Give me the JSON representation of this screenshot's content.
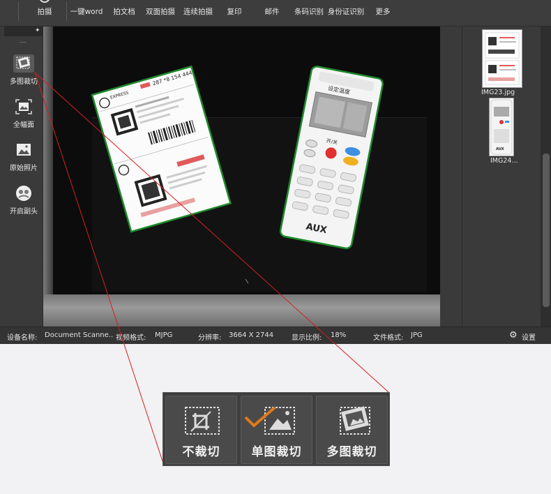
{
  "toolbar": {
    "capture_label": "拍摄",
    "word_label": "一键word",
    "doc_label": "拍文档",
    "duplex_label": "双面拍摄",
    "continuous_label": "连续拍摄",
    "copy_label": "复印",
    "mail_label": "邮件",
    "barcode_label": "条码识别",
    "idcard_label": "身份证识别",
    "more_label": "更多"
  },
  "sidebar": {
    "items": [
      {
        "label": "多图裁切",
        "icon": "multi-crop-icon",
        "active": true
      },
      {
        "label": "全幅面",
        "icon": "full-frame-icon",
        "active": false
      },
      {
        "label": "原始照片",
        "icon": "original-photo-icon",
        "active": false
      },
      {
        "label": "开启副头",
        "icon": "secondary-camera-icon",
        "active": false
      }
    ]
  },
  "thumbnails": [
    {
      "name": "IMG23.jpg"
    },
    {
      "name": "IMG24..."
    }
  ],
  "preview": {
    "waybill_brand": "EXPRESS",
    "waybill_number": "287 *8 154 444",
    "remote_title": "设定温度",
    "remote_power_label": "开/关",
    "remote_brand": "AUX"
  },
  "status": {
    "device_label": "设备名称:",
    "device_value": "Document Scanne..",
    "format_label": "视频格式:",
    "format_value": "MJPG",
    "resolution_label": "分辨率:",
    "resolution_value": "3664 X 2744",
    "zoom_label": "显示比例:",
    "zoom_value": "18%",
    "filetype_label": "文件格式:",
    "filetype_value": "JPG",
    "settings_label": "设置"
  },
  "callout": {
    "items": [
      {
        "label": "不裁切",
        "icon": "no-crop-icon"
      },
      {
        "label": "单图裁切",
        "icon": "single-crop-icon"
      },
      {
        "label": "多图裁切",
        "icon": "multi-crop-icon"
      }
    ]
  },
  "colors": {
    "crop_outline": "#1f8a2c",
    "annotation_line": "#d81e1e",
    "check_mark": "#e07a1a",
    "remote_red": "#e03030",
    "remote_blue": "#3d8fe0",
    "remote_yellow": "#f0b020"
  }
}
